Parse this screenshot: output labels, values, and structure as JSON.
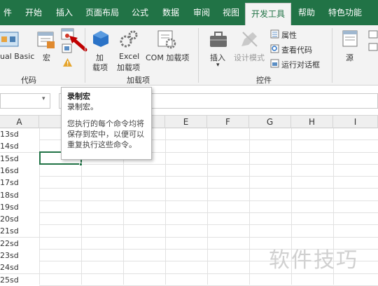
{
  "tabs": [
    "件",
    "开始",
    "插入",
    "页面布局",
    "公式",
    "数据",
    "审阅",
    "视图",
    "开发工具",
    "帮助",
    "特色功能"
  ],
  "active_tab": "开发工具",
  "ribbon": {
    "vb_label": "ual Basic",
    "macro_label": "宏",
    "group_code": "代码",
    "addins_label1": "加",
    "addins_label2": "载项",
    "excel_addins1": "Excel",
    "excel_addins2": "加载项",
    "com_addins": "COM 加载项",
    "group_addins": "加载项",
    "insert_label": "插入",
    "insert_arrow": "▾",
    "design_mode": "设计模式",
    "properties": "属性",
    "view_code": "查看代码",
    "run_dialog": "运行对话框",
    "group_controls": "控件",
    "source_label": "源",
    "warning_icon": "warning-icon"
  },
  "formula_bar": {
    "namebox_arrow": "▾"
  },
  "columns": [
    "A",
    "E",
    "F",
    "G",
    "H",
    "I"
  ],
  "rows": [
    "13sd",
    "14sd",
    "15sd",
    "16sd",
    "17sd",
    "18sd",
    "19sd",
    "20sd",
    "21sd",
    "22sd",
    "23sd",
    "24sd",
    "25sd"
  ],
  "tooltip": {
    "title": "录制宏",
    "subtitle": "录制宏。",
    "body": "您执行的每个命令均将保存到宏中，以便可以重复执行这些命令。"
  },
  "watermark": "软件技巧",
  "colors": {
    "brand": "#217346",
    "arrow": "#c00000",
    "selection": "#217346"
  }
}
